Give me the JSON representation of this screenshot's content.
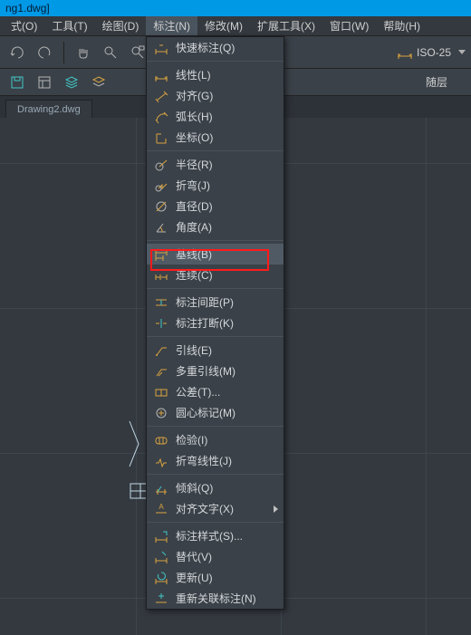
{
  "title_fragment": "ng1.dwg]",
  "menus": {
    "m0": "式(O)",
    "m1": "工具(T)",
    "m2": "绘图(D)",
    "m3": "标注(N)",
    "m4": "修改(M)",
    "m5": "扩展工具(X)",
    "m6": "窗口(W)",
    "m7": "帮助(H)"
  },
  "toolbar": {
    "style_combo": "ISO-25",
    "layer_label": "随层"
  },
  "document_tab": "Drawing2.dwg",
  "dropdown": [
    {
      "label": "快速标注(Q)",
      "icon": "quick-dim"
    },
    null,
    {
      "label": "线性(L)",
      "icon": "linear"
    },
    {
      "label": "对齐(G)",
      "icon": "aligned"
    },
    {
      "label": "弧长(H)",
      "icon": "arc-length"
    },
    {
      "label": "坐标(O)",
      "icon": "ordinate"
    },
    null,
    {
      "label": "半径(R)",
      "icon": "radius"
    },
    {
      "label": "折弯(J)",
      "icon": "jogged"
    },
    {
      "label": "直径(D)",
      "icon": "diameter"
    },
    {
      "label": "角度(A)",
      "icon": "angular"
    },
    null,
    {
      "label": "基线(B)",
      "icon": "baseline",
      "hover": true
    },
    {
      "label": "连续(C)",
      "icon": "continue"
    },
    null,
    {
      "label": "标注间距(P)",
      "icon": "dim-space"
    },
    {
      "label": "标注打断(K)",
      "icon": "dim-break"
    },
    null,
    {
      "label": "引线(E)",
      "icon": "leader"
    },
    {
      "label": "多重引线(M)",
      "icon": "mleader"
    },
    {
      "label": "公差(T)...",
      "icon": "tolerance"
    },
    {
      "label": "圆心标记(M)",
      "icon": "center-mark"
    },
    null,
    {
      "label": "检验(I)",
      "icon": "inspect"
    },
    {
      "label": "折弯线性(J)",
      "icon": "jog-linear"
    },
    null,
    {
      "label": "倾斜(Q)",
      "icon": "oblique"
    },
    {
      "label": "对齐文字(X)",
      "icon": "align-text",
      "submenu": true
    },
    null,
    {
      "label": "标注样式(S)...",
      "icon": "dim-style"
    },
    {
      "label": "替代(V)",
      "icon": "override"
    },
    {
      "label": "更新(U)",
      "icon": "update"
    },
    {
      "label": "重新关联标注(N)",
      "icon": "reassoc"
    }
  ]
}
